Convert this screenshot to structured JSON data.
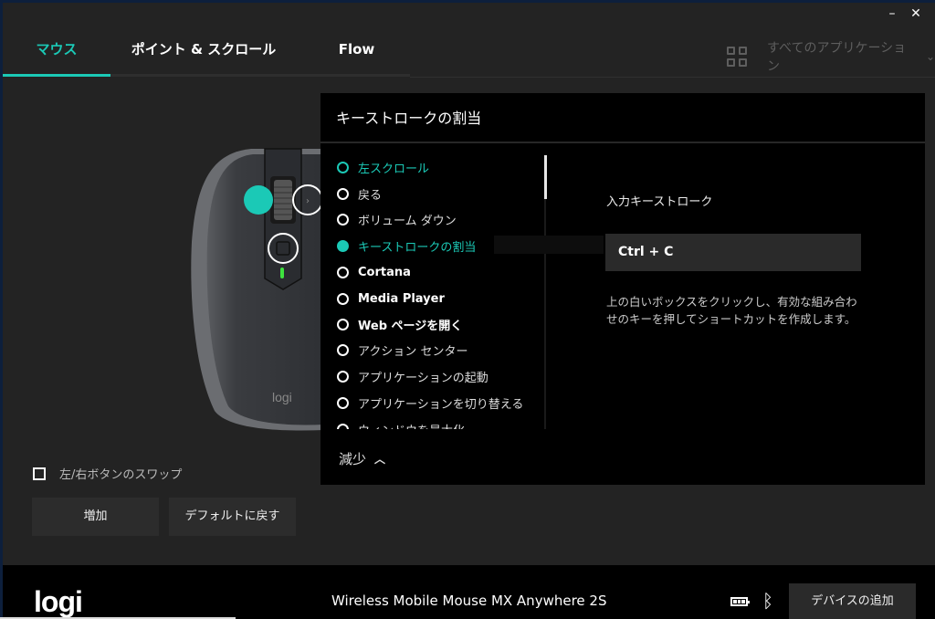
{
  "window": {
    "minimize_icon": "minimize-icon",
    "close_icon": "close-icon",
    "minimize_label": "–",
    "close_label": "✕"
  },
  "tabs": [
    {
      "label": "マウス",
      "active": true
    },
    {
      "label": "ポイント & スクロール",
      "active": false
    },
    {
      "label": "Flow",
      "active": false
    }
  ],
  "app_selector": {
    "icon": "grid-icon",
    "label": "すべてのアプリケーション",
    "chevron": "⌄"
  },
  "accent_color": "#1bc9b6",
  "panel": {
    "title": "キーストロークの割当",
    "actions": [
      {
        "label": "左スクロール",
        "state": "current"
      },
      {
        "label": "戻る",
        "state": "none"
      },
      {
        "label": "ボリューム ダウン",
        "state": "none"
      },
      {
        "label": "キーストロークの割当",
        "state": "selected"
      },
      {
        "label": "Cortana",
        "state": "none"
      },
      {
        "label": "Media Player",
        "state": "none"
      },
      {
        "label": "Web ページを開く",
        "state": "none"
      },
      {
        "label": "アクション センター",
        "state": "none"
      },
      {
        "label": "アプリケーションの起動",
        "state": "none"
      },
      {
        "label": "アプリケーションを切り替える",
        "state": "none"
      },
      {
        "label": "ウィンドウを最大化",
        "state": "none"
      }
    ],
    "less_label": "減少",
    "less_icon": "chevron-up-icon",
    "keystroke_label": "入力キーストローク",
    "keystroke_value": "Ctrl + C",
    "help_text": "上の白いボックスをクリックし、有効な組み合わせのキーを押してショートカットを作成します。"
  },
  "left": {
    "swap_label": "左/右ボタンのスワップ",
    "swap_checked": false,
    "add_button": "増加",
    "default_button": "デフォルトに戻す"
  },
  "footer": {
    "logo": "logi",
    "device_name": "Wireless Mobile Mouse MX Anywhere 2S",
    "battery_icon": "battery-icon",
    "bluetooth_icon": "bluetooth-icon",
    "bluetooth_glyph": "ᛒ",
    "add_device_button": "デバイスの追加"
  },
  "mouse": {
    "logo_text": "logi"
  }
}
